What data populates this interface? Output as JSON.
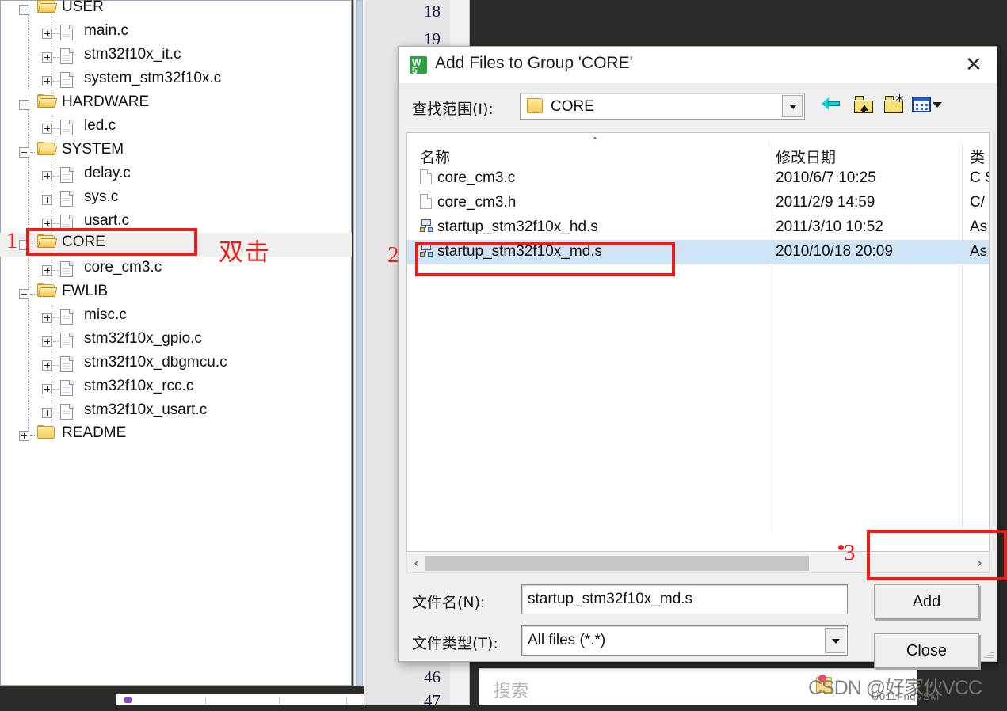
{
  "ide": {
    "gutter_line_numbers": [
      "18",
      "19",
      "46",
      "47"
    ],
    "search_placeholder": "搜索",
    "watermark": "CSDN @好家伙VCC",
    "watermark_sub": "U011FnqVSM"
  },
  "tree": {
    "groups": [
      {
        "label": "USER",
        "expanded": true,
        "files": [
          "main.c",
          "stm32f10x_it.c",
          "system_stm32f10x.c"
        ]
      },
      {
        "label": "HARDWARE",
        "expanded": true,
        "files": [
          "led.c"
        ]
      },
      {
        "label": "SYSTEM",
        "expanded": true,
        "files": [
          "delay.c",
          "sys.c",
          "usart.c"
        ]
      },
      {
        "label": "CORE",
        "expanded": true,
        "files": [
          "core_cm3.c"
        ]
      },
      {
        "label": "FWLIB",
        "expanded": true,
        "files": [
          "misc.c",
          "stm32f10x_gpio.c",
          "stm32f10x_dbgmcu.c",
          "stm32f10x_rcc.c",
          "stm32f10x_usart.c"
        ]
      },
      {
        "label": "README",
        "expanded": false,
        "files": []
      }
    ],
    "rows": [
      {
        "label": "USER",
        "kind": "folder"
      },
      {
        "label": "main.c",
        "kind": "file"
      },
      {
        "label": "stm32f10x_it.c",
        "kind": "file"
      },
      {
        "label": "system_stm32f10x.c",
        "kind": "file"
      },
      {
        "label": "HARDWARE",
        "kind": "folder"
      },
      {
        "label": "led.c",
        "kind": "file"
      },
      {
        "label": "SYSTEM",
        "kind": "folder"
      },
      {
        "label": "delay.c",
        "kind": "file"
      },
      {
        "label": "sys.c",
        "kind": "file"
      },
      {
        "label": "usart.c",
        "kind": "file"
      },
      {
        "label": "CORE",
        "kind": "folder"
      },
      {
        "label": "core_cm3.c",
        "kind": "file"
      },
      {
        "label": "FWLIB",
        "kind": "folder"
      },
      {
        "label": "misc.c",
        "kind": "file"
      },
      {
        "label": "stm32f10x_gpio.c",
        "kind": "file"
      },
      {
        "label": "stm32f10x_dbgmcu.c",
        "kind": "file"
      },
      {
        "label": "stm32f10x_rcc.c",
        "kind": "file"
      },
      {
        "label": "stm32f10x_usart.c",
        "kind": "file"
      },
      {
        "label": "README",
        "kind": "folder-collapsed"
      }
    ]
  },
  "annotations": {
    "step1": "1",
    "step1_hint": "双击",
    "step2": "2",
    "step3": "3",
    "color": "#EE1C19"
  },
  "dialog": {
    "title": "Add Files to Group 'CORE'",
    "close_label": "✕",
    "lookin_label": "查找范围(I):",
    "lookin_value": "CORE",
    "toolbar": [
      {
        "name": "back-icon",
        "tooltip": "Back"
      },
      {
        "name": "up-folder-icon",
        "tooltip": "Up One Level"
      },
      {
        "name": "new-folder-icon",
        "tooltip": "Create New Folder"
      },
      {
        "name": "views-icon",
        "tooltip": "Views"
      }
    ],
    "columns": [
      "名称",
      "修改日期",
      "类型"
    ],
    "column_type_truncated": "类",
    "sort_indicator": "⌃",
    "files": [
      {
        "name": "core_cm3.c",
        "date": "2010/6/7 10:25",
        "type": "C S",
        "icon": "c-file-icon",
        "selected": false
      },
      {
        "name": "core_cm3.h",
        "date": "2011/2/9 14:59",
        "type": "C/",
        "icon": "c-file-icon",
        "selected": false
      },
      {
        "name": "startup_stm32f10x_hd.s",
        "date": "2011/3/10 10:52",
        "type": "As",
        "icon": "asm-file-icon",
        "selected": false
      },
      {
        "name": "startup_stm32f10x_md.s",
        "date": "2010/10/18 20:09",
        "type": "As",
        "icon": "asm-file-icon",
        "selected": true
      }
    ],
    "scroll_left_arrow": "‹",
    "scroll_right_arrow": "›",
    "filename_label": "文件名(N):",
    "filename_value": "startup_stm32f10x_md.s",
    "filetype_label": "文件类型(T):",
    "filetype_value": "All files (*.*)",
    "add_label": "Add",
    "close_button_label": "Close"
  }
}
